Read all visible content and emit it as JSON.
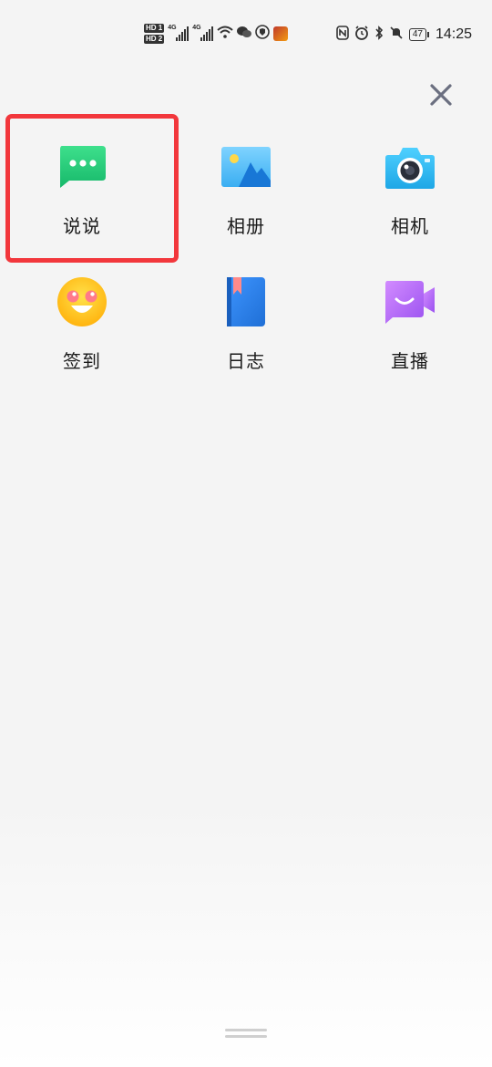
{
  "status_bar": {
    "hd1": "HD 1",
    "hd2": "HD 2",
    "network1": "4G",
    "network2": "4G",
    "battery": "47",
    "time": "14:25"
  },
  "menu": {
    "items": [
      {
        "label": "说说",
        "icon": "chat-bubble-icon"
      },
      {
        "label": "相册",
        "icon": "photo-album-icon"
      },
      {
        "label": "相机",
        "icon": "camera-icon"
      },
      {
        "label": "签到",
        "icon": "smiley-checkin-icon"
      },
      {
        "label": "日志",
        "icon": "journal-book-icon"
      },
      {
        "label": "直播",
        "icon": "live-video-icon"
      }
    ],
    "highlighted_index": 0
  },
  "colors": {
    "highlight_border": "#f2373c",
    "close_icon": "#6b6f80",
    "chat_green": "#2ed07a",
    "album_blue": "#3aaef2",
    "camera_blue": "#2ab7f0",
    "checkin_yellow": "#ffc21a",
    "journal_blue": "#2f7fe0",
    "live_purple": "#b56cf5"
  }
}
